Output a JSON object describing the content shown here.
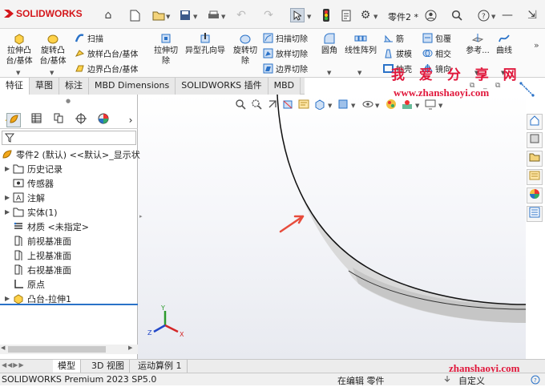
{
  "app": {
    "logo": "SOLIDWORKS",
    "doc_title": "零件2 *"
  },
  "commands": {
    "extrude_boss": "拉伸凸\n台/基体",
    "revolve_boss": "旋转凸\n台/基体",
    "sweep": "扫描",
    "loft": "放样凸台/基体",
    "boundary_boss": "边界凸台/基体",
    "extrude_cut": "拉伸切\n除",
    "hole_wizard": "异型孔向导",
    "revolve_cut": "旋转切\n除",
    "swept_cut": "扫描切除",
    "lofted_cut": "放样切除",
    "boundary_cut": "边界切除",
    "fillet": "圆角",
    "linear_pattern": "线性阵列",
    "rib": "筋",
    "draft": "拔模",
    "shell": "抽壳",
    "wrap": "包覆",
    "intersect": "相交",
    "mirror": "镜向",
    "reference": "参考...",
    "curves": "曲线"
  },
  "tabs": [
    "特征",
    "草图",
    "标注",
    "MBD Dimensions",
    "SOLIDWORKS 插件",
    "MBD"
  ],
  "tree": {
    "root": "零件2 (默认) <<默认>_显示状",
    "items": [
      "历史记录",
      "传感器",
      "注解",
      "实体(1)",
      "材质 <未指定>",
      "前视基准面",
      "上视基准面",
      "右视基准面",
      "原点",
      "凸台-拉伸1"
    ]
  },
  "watermark": {
    "cn": "我 爱 分 享 网",
    "url": "www.zhanshaoyi.com",
    "bottom": "zhanshaoyi.com"
  },
  "bottom_tabs": [
    "模型",
    "3D 视图",
    "运动算例 1"
  ],
  "status": {
    "left": "SOLIDWORKS Premium 2023 SP5.0",
    "mode": "在编辑 零件",
    "units": "自定义"
  },
  "colors": {
    "accent": "#2a72c8",
    "brand": "#d4161b",
    "watermark": "#e0183c"
  }
}
